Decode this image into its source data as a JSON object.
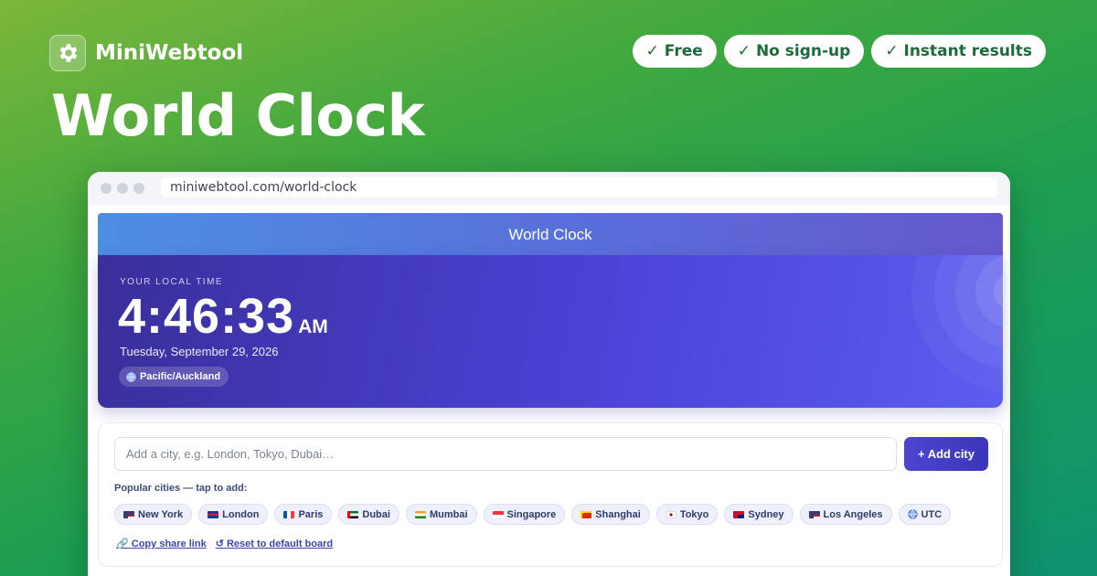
{
  "brand": {
    "name": "MiniWebtool",
    "icon": "gear-icon"
  },
  "badges": [
    "✓ Free",
    "✓ No sign-up",
    "✓ Instant results"
  ],
  "hero": {
    "title": "World Clock"
  },
  "browser": {
    "url": "miniwebtool.com/world-clock"
  },
  "app": {
    "header_title": "World Clock",
    "local_label": "YOUR LOCAL TIME",
    "time": "4:46:33",
    "ampm": "AM",
    "date": "Tuesday, September 29, 2026",
    "timezone": "Pacific/Auckland"
  },
  "search": {
    "placeholder": "Add a city, e.g. London, Tokyo, Dubai…",
    "add_label": "+ Add city"
  },
  "popular": {
    "label": "Popular cities — tap to add:",
    "cities": [
      {
        "label": "New York",
        "flag": "us-flag-icon"
      },
      {
        "label": "London",
        "flag": "gb-flag-icon"
      },
      {
        "label": "Paris",
        "flag": "fr-flag-icon"
      },
      {
        "label": "Dubai",
        "flag": "ae-flag-icon"
      },
      {
        "label": "Mumbai",
        "flag": "in-flag-icon"
      },
      {
        "label": "Singapore",
        "flag": "sg-flag-icon"
      },
      {
        "label": "Shanghai",
        "flag": "cn-flag-icon"
      },
      {
        "label": "Tokyo",
        "flag": "jp-flag-icon"
      },
      {
        "label": "Sydney",
        "flag": "au-flag-icon"
      },
      {
        "label": "Los Angeles",
        "flag": "us-flag-icon"
      },
      {
        "label": "UTC",
        "flag": "globe-icon"
      }
    ]
  },
  "links": {
    "copy": "Copy share link",
    "reset": "Reset to default board"
  },
  "colors": {
    "accent": "#4a40d2",
    "badge_text": "#1d6b3b",
    "header_start": "#4d8ee4",
    "header_end": "#6558cc"
  }
}
